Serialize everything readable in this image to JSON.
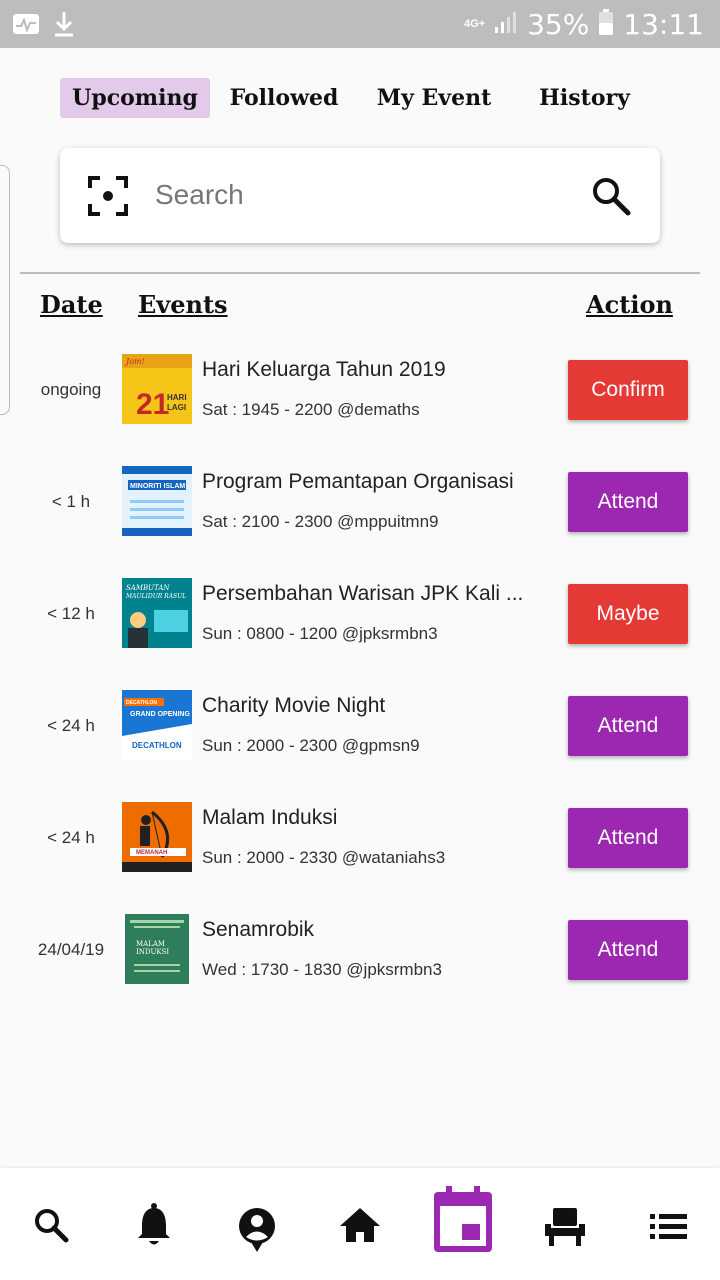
{
  "status_bar": {
    "network": "4G+",
    "battery": "35%",
    "time": "13:11"
  },
  "tabs": [
    {
      "label": "Upcoming",
      "active": true
    },
    {
      "label": "Followed",
      "active": false
    },
    {
      "label": "My Event",
      "active": false
    },
    {
      "label": "History",
      "active": false
    }
  ],
  "search": {
    "placeholder": "Search",
    "value": ""
  },
  "table": {
    "headers": {
      "date": "Date",
      "events": "Events",
      "action": "Action"
    },
    "rows": [
      {
        "date": "ongoing",
        "title": "Hari Keluarga Tahun 2019",
        "detail": "Sat : 1945 - 2200 @demaths",
        "action": "Confirm",
        "action_color": "#e53935",
        "thumb_text": "21 HARI LAGI"
      },
      {
        "date": "< 1 h",
        "title": "Program Pemantapan Organisasi",
        "detail": "Sat : 2100 - 2300 @mppuitmn9",
        "action": "Attend",
        "action_color": "#9c27b0",
        "thumb_text": "MINORITI ISLAM"
      },
      {
        "date": "< 12 h",
        "title": "Persembahan Warisan JPK Kali ...",
        "detail": "Sun : 0800 - 1200 @jpksrmbn3",
        "action": "Maybe",
        "action_color": "#e53935",
        "thumb_text": "SAMBUTAN MAULIDUR RASUL"
      },
      {
        "date": "< 24 h",
        "title": "Charity Movie Night",
        "detail": "Sun : 2000 - 2300 @gpmsn9",
        "action": "Attend",
        "action_color": "#9c27b0",
        "thumb_text": "GRAND OPENING DECATHLON"
      },
      {
        "date": "< 24 h",
        "title": "Malam Induksi",
        "detail": "Sun : 2000 - 2330 @wataniahs3",
        "action": "Attend",
        "action_color": "#9c27b0",
        "thumb_text": "MEMANAH"
      },
      {
        "date": "24/04/19",
        "title": "Senamrobik",
        "detail": "Wed : 1730 - 1830 @jpksrmbn3",
        "action": "Attend",
        "action_color": "#9c27b0",
        "thumb_text": "MALAM INDUKSI"
      }
    ]
  },
  "bottom_nav": [
    {
      "icon": "search-icon",
      "active": false
    },
    {
      "icon": "bell-icon",
      "active": false
    },
    {
      "icon": "account-icon",
      "active": false
    },
    {
      "icon": "home-icon",
      "active": false
    },
    {
      "icon": "calendar-icon",
      "active": true
    },
    {
      "icon": "seat-icon",
      "active": false
    },
    {
      "icon": "list-icon",
      "active": false
    }
  ],
  "colors": {
    "accent": "#9c27b0",
    "danger": "#e53935",
    "tab_active_bg": "#e3c9ea"
  }
}
